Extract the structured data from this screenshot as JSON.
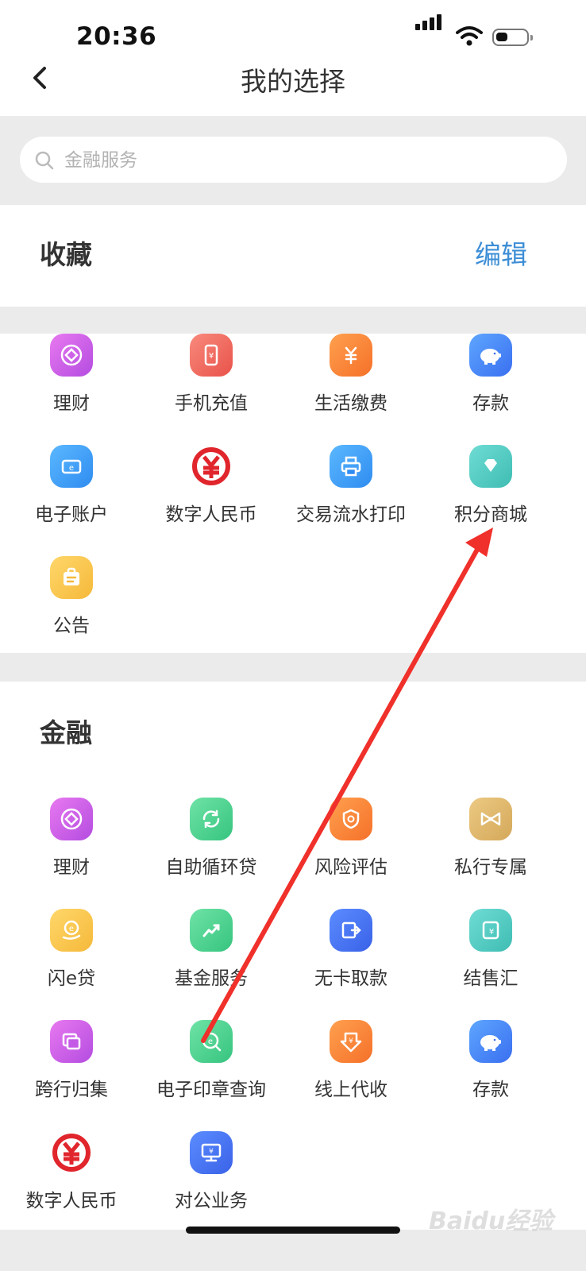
{
  "status_bar": {
    "time": "20:36"
  },
  "nav": {
    "title": "我的选择"
  },
  "search": {
    "placeholder": "金融服务"
  },
  "favorites": {
    "title": "收藏",
    "edit_label": "编辑",
    "items": [
      {
        "label": "理财",
        "icon": "wealth-icon"
      },
      {
        "label": "手机充值",
        "icon": "phone-topup-icon"
      },
      {
        "label": "生活缴费",
        "icon": "bill-payment-icon"
      },
      {
        "label": "存款",
        "icon": "piggy-bank-icon"
      },
      {
        "label": "电子账户",
        "icon": "e-account-icon"
      },
      {
        "label": "数字人民币",
        "icon": "digital-rmb-icon"
      },
      {
        "label": "交易流水打印",
        "icon": "printer-icon"
      },
      {
        "label": "积分商城",
        "icon": "diamond-icon"
      },
      {
        "label": "公告",
        "icon": "announcement-icon"
      }
    ]
  },
  "finance": {
    "title": "金融",
    "items": [
      {
        "label": "理财",
        "icon": "wealth-icon"
      },
      {
        "label": "自助循环贷",
        "icon": "revolving-loan-icon"
      },
      {
        "label": "风险评估",
        "icon": "risk-shield-icon"
      },
      {
        "label": "私行专属",
        "icon": "bow-icon"
      },
      {
        "label": "闪e贷",
        "icon": "flash-loan-icon"
      },
      {
        "label": "基金服务",
        "icon": "fund-chart-icon"
      },
      {
        "label": "无卡取款",
        "icon": "cardless-withdraw-icon"
      },
      {
        "label": "结售汇",
        "icon": "currency-exchange-icon"
      },
      {
        "label": "跨行归集",
        "icon": "cross-bank-icon"
      },
      {
        "label": "电子印章查询",
        "icon": "e-seal-icon"
      },
      {
        "label": "线上代收",
        "icon": "online-collection-icon"
      },
      {
        "label": "存款",
        "icon": "piggy-bank-icon"
      },
      {
        "label": "数字人民币",
        "icon": "digital-rmb-icon"
      },
      {
        "label": "对公业务",
        "icon": "corporate-icon"
      }
    ]
  },
  "colors": {
    "accent": "#3d8ed6",
    "annotation_arrow": "#f0302a",
    "section_gap": "#ebebeb"
  },
  "watermark": "Baidu经验"
}
